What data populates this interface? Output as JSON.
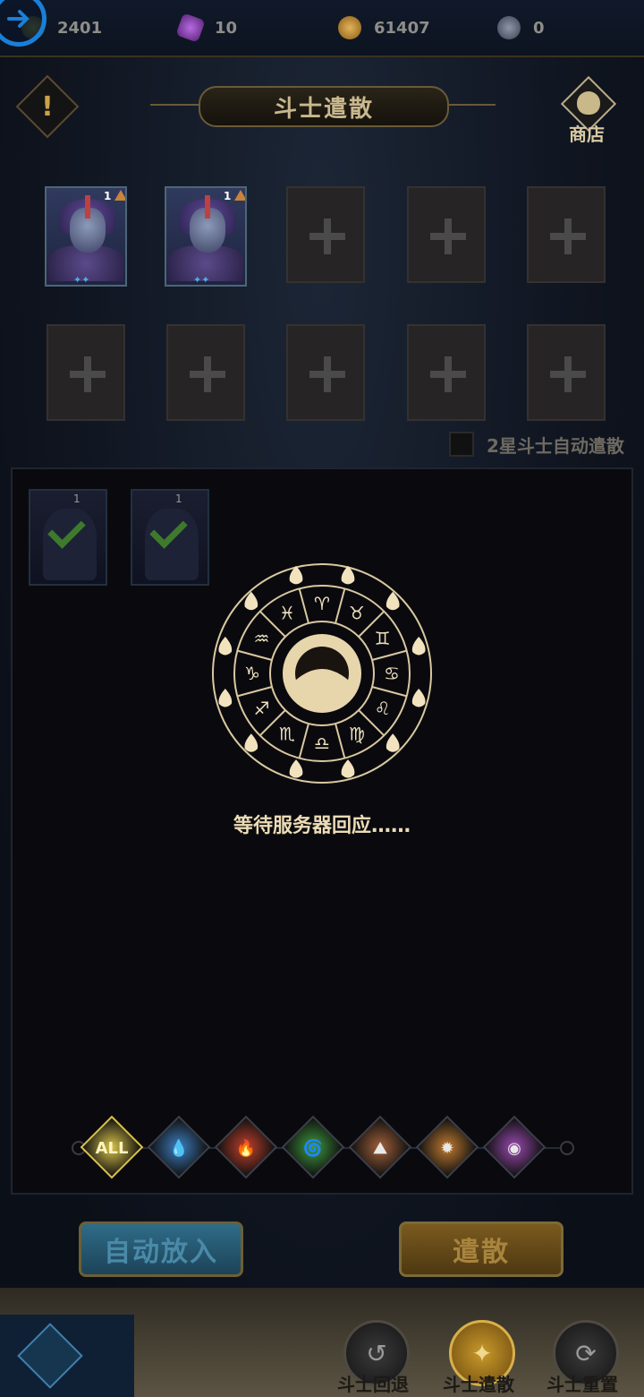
{
  "resources": [
    {
      "icon": "stamina-icon",
      "value": "2401"
    },
    {
      "icon": "gem-icon",
      "value": "10"
    },
    {
      "icon": "gold-coin-icon",
      "value": "61407"
    },
    {
      "icon": "silver-coin-icon",
      "value": "0"
    }
  ],
  "header": {
    "title": "斗士遣散",
    "alert_glyph": "!",
    "shop_label": "商店"
  },
  "dismiss_slots": {
    "cards": [
      {
        "level": "1"
      },
      {
        "level": "1"
      }
    ],
    "empty_slot_count": 8
  },
  "auto_dismiss": {
    "label": "2星斗士自动遣散",
    "checked": false
  },
  "selected_cards": [
    {
      "level": "1",
      "checked": true
    },
    {
      "level": "1",
      "checked": true
    }
  ],
  "loading": {
    "text": "等待服务器回应……",
    "zodiac": [
      "♈",
      "♉",
      "♊",
      "♋",
      "♌",
      "♍",
      "♎",
      "♏",
      "♐",
      "♑",
      "♒",
      "♓"
    ]
  },
  "filters": [
    {
      "name": "all",
      "label": "ALL",
      "color": "#d8c24a"
    },
    {
      "name": "water",
      "label": "💧",
      "color": "#3d7ec0"
    },
    {
      "name": "fire",
      "label": "🔥",
      "color": "#c0402c"
    },
    {
      "name": "wind",
      "label": "🌀",
      "color": "#3e9a3e"
    },
    {
      "name": "earth",
      "label": "⛰",
      "color": "#a0603a"
    },
    {
      "name": "light",
      "label": "✹",
      "color": "#c07a30"
    },
    {
      "name": "dark",
      "label": "◉",
      "color": "#9a4ab0"
    }
  ],
  "buttons": {
    "auto_fill": "自动放入",
    "dismiss": "遣散"
  },
  "bottom_nav": [
    {
      "label": "斗士回退",
      "glyph": "↺",
      "active": false
    },
    {
      "label": "斗士遣散",
      "glyph": "✦",
      "active": true
    },
    {
      "label": "斗士重置",
      "glyph": "⟳",
      "active": false
    }
  ]
}
